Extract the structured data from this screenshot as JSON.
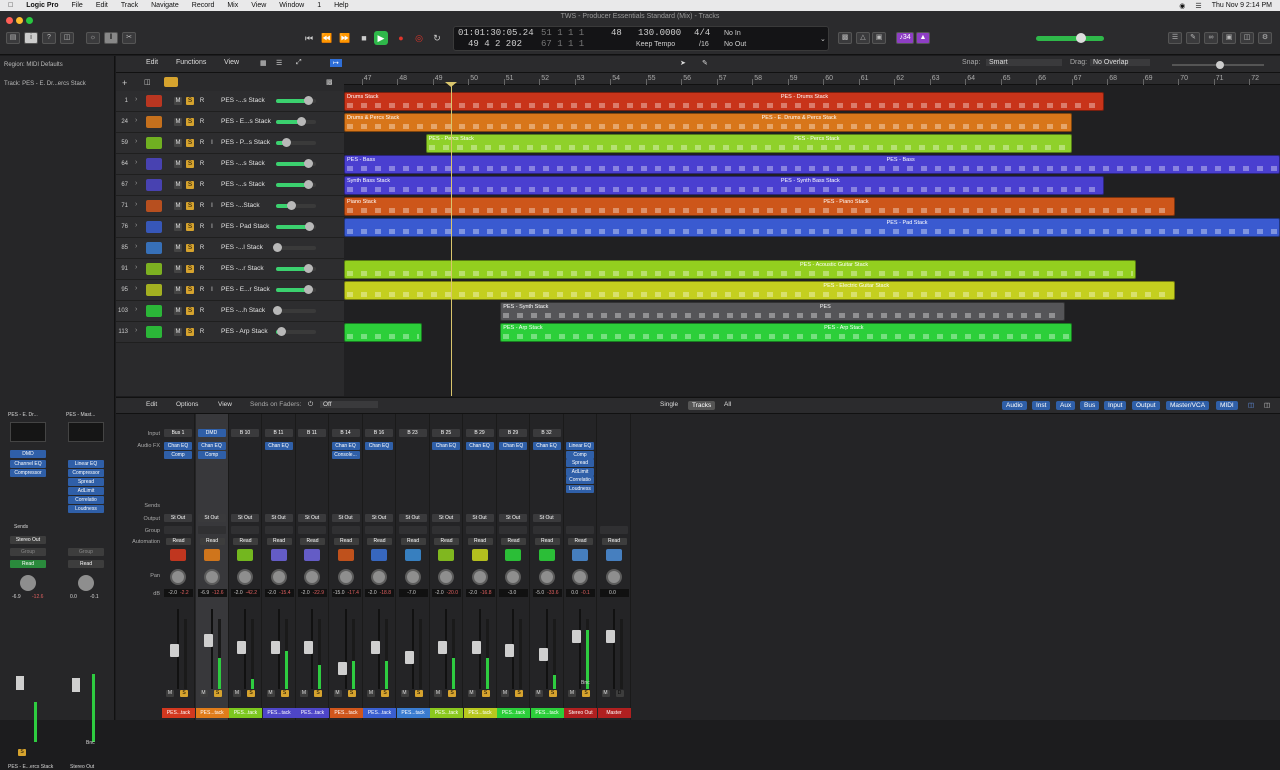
{
  "menubar": {
    "app": "Logic Pro",
    "items": [
      "File",
      "Edit",
      "Track",
      "Navigate",
      "Record",
      "Mix",
      "View",
      "Window",
      "1",
      "Help"
    ],
    "clock": "Thu Nov 9  2:14 PM"
  },
  "window": {
    "title": "TWS - Producer Essentials Standard (Mix) - Tracks"
  },
  "lcd": {
    "time": "01:01:30:05.24",
    "bars": "49  4  2  202",
    "loc1": "51  1  1     1",
    "loc2": "67  1  1     1",
    "bar_num": "48",
    "tempo": "130.0000",
    "tempo_label": "Keep Tempo",
    "sig": "4/4",
    "div": "/16",
    "in": "No In",
    "out": "No Out",
    "badge": "♪34"
  },
  "inspector": {
    "region": "Region: MIDI Defaults",
    "track": "Track: PES - E. Dr...ercs Stack",
    "strip1": {
      "name": "PES - E. Dr...",
      "setting": "DMD",
      "fx": [
        "Channel EQ",
        "Compressor"
      ],
      "sends": "Sends",
      "out": "Stereo Out",
      "group": "Group",
      "read": "Read",
      "db1": "-6.9",
      "db2": "-12.6",
      "label": "PES - E...ercs Stack"
    },
    "strip2": {
      "name": "PES - Mast...",
      "fx": [
        "Linear EQ",
        "Compressor",
        "Spread",
        "AdLimit",
        "Correlatio",
        "Loudness"
      ],
      "out": "Stereo Out",
      "group": "Group",
      "read": "Read",
      "db1": "0.0",
      "db2": "-0.1",
      "bnc": "Bnc",
      "label": "Stereo Out"
    }
  },
  "mainhdr": {
    "edit": "Edit",
    "functions": "Functions",
    "view": "View",
    "snap_label": "Snap:",
    "snap": "Smart",
    "drag_label": "Drag:",
    "drag": "No Overlap"
  },
  "ruler": [
    "47",
    "48",
    "49",
    "50",
    "51",
    "52",
    "53",
    "54",
    "55",
    "56",
    "57",
    "58",
    "59",
    "60",
    "61",
    "62",
    "63",
    "64",
    "65",
    "66",
    "67",
    "68",
    "69",
    "70",
    "71",
    "72"
  ],
  "tracks": [
    {
      "num": "1",
      "name": "PES -...s Stack",
      "color": "#d2381f",
      "vol": 0.85,
      "m": "M",
      "s": "S",
      "r": "R",
      "i": ""
    },
    {
      "num": "24",
      "name": "PES - E...s Stack",
      "color": "#e07c1a",
      "vol": 0.68,
      "m": "M",
      "s": "S",
      "r": "R",
      "i": ""
    },
    {
      "num": "59",
      "name": "PES - P...s Stack",
      "color": "#7cc81f",
      "vol": 0.25,
      "m": "M",
      "s": "S",
      "r": "R",
      "i": "I"
    },
    {
      "num": "64",
      "name": "PES -...s Stack",
      "color": "#4e46c8",
      "vol": 0.85,
      "m": "M",
      "s": "S",
      "r": "R",
      "i": ""
    },
    {
      "num": "67",
      "name": "PES -...s Stack",
      "color": "#4e46c8",
      "vol": 0.85,
      "m": "M",
      "s": "S",
      "r": "R",
      "i": ""
    },
    {
      "num": "71",
      "name": "PES -...Stack",
      "color": "#d0561c",
      "vol": 0.4,
      "m": "M",
      "s": "S",
      "r": "R",
      "i": "I"
    },
    {
      "num": "76",
      "name": "PES - Pad Stack",
      "color": "#3a5fd0",
      "vol": 0.9,
      "m": "M",
      "s": "S",
      "r": "R",
      "i": "I"
    },
    {
      "num": "85",
      "name": "PES -...l Stack",
      "color": "#3a7cd0",
      "vol": 0.0,
      "m": "M",
      "s": "S",
      "r": "R",
      "i": ""
    },
    {
      "num": "91",
      "name": "PES -...r Stack",
      "color": "#8bc81f",
      "vol": 0.85,
      "m": "M",
      "s": "S",
      "r": "R",
      "i": ""
    },
    {
      "num": "95",
      "name": "PES - E...r Stack",
      "color": "#b8c81f",
      "vol": 0.85,
      "m": "M",
      "s": "S",
      "r": "R",
      "i": "I"
    },
    {
      "num": "103",
      "name": "PES -...h Stack",
      "color": "#2ccf3a",
      "vol": 0.0,
      "m": "M",
      "s": "S",
      "r": "R",
      "i": ""
    },
    {
      "num": "113",
      "name": "PES - Arp Stack",
      "color": "#2ccf3a",
      "vol": 0.1,
      "m": "M",
      "s": "S",
      "r": "R",
      "i": ""
    }
  ],
  "regions": [
    {
      "row": 0,
      "start": 46.5,
      "end": 67.9,
      "color": "#c8341a",
      "labels": [
        "Drums Stack",
        "PES - Drums Stack"
      ]
    },
    {
      "row": 1,
      "start": 46.5,
      "end": 67.0,
      "color": "#d8761a",
      "labels": [
        "Drums & Percs Stack",
        "PES - E. Drums & Percs Stack"
      ]
    },
    {
      "row": 2,
      "start": 48.8,
      "end": 67.0,
      "color": "#8fd12a",
      "labels": [
        "PES - Percs Stack",
        "PES - Percs Stack"
      ]
    },
    {
      "row": 3,
      "start": 46.5,
      "end": 73.0,
      "color": "#4a3fd0",
      "labels": [
        "PES - Bass",
        "PES - Bass"
      ]
    },
    {
      "row": 4,
      "start": 46.5,
      "end": 67.9,
      "color": "#4a3fd0",
      "labels": [
        "Synth Bass Stack",
        "PES - Synth Bass Stack"
      ]
    },
    {
      "row": 5,
      "start": 46.5,
      "end": 69.9,
      "color": "#cd561a",
      "labels": [
        "Piano Stack",
        "PES - Piano Stack"
      ]
    },
    {
      "row": 6,
      "start": 46.5,
      "end": 73.0,
      "color": "#3a5ad0",
      "labels": [
        "",
        "PES - Pad Stack"
      ]
    },
    {
      "row": 8,
      "start": 46.5,
      "end": 68.8,
      "color": "#93cf1f",
      "labels": [
        "",
        "PES - Acoustic Guitar Stack"
      ]
    },
    {
      "row": 9,
      "start": 46.5,
      "end": 69.9,
      "color": "#c4cf1f",
      "labels": [
        "",
        "PES - Electric Guitar Stack"
      ]
    },
    {
      "row": 10,
      "start": 50.9,
      "end": 66.8,
      "color": "#555558",
      "labels": [
        "PES - Synth Stack",
        "PES"
      ]
    },
    {
      "row": 11,
      "start": 46.5,
      "end": 48.7,
      "color": "#2ccf3a",
      "labels": [
        "",
        ""
      ]
    },
    {
      "row": 11,
      "start": 50.9,
      "end": 67.0,
      "color": "#2ccf3a",
      "labels": [
        "PES - Arp Stack",
        "PES - Arp Stack"
      ]
    }
  ],
  "mixhdr": {
    "edit": "Edit",
    "options": "Options",
    "view": "View",
    "sends_label": "Sends on Faders:",
    "sends_val": "Off",
    "single": "Single",
    "tracks": "Tracks",
    "all": "All",
    "filters": [
      "Audio",
      "Inst",
      "Aux",
      "Bus",
      "Input",
      "Output",
      "Master/VCA",
      "MIDI"
    ]
  },
  "mixlabels": {
    "input": "Input",
    "fx": "Audio FX",
    "sends": "Sends",
    "output": "Output",
    "group": "Group",
    "auto": "Automation",
    "pan": "Pan",
    "db": "dB"
  },
  "channels": [
    {
      "input": "Bus 1",
      "fx": [
        "Chan EQ",
        "Comp"
      ],
      "out": "St Out",
      "read": "Read",
      "db1": "-2.0",
      "db2": "-2.2",
      "fader": 0.5,
      "meter": 0.0,
      "color": "#d2381f",
      "icon": "#d2381f",
      "name": "PES...tack"
    },
    {
      "input": "DMD",
      "fx": [
        "Chan EQ",
        "Comp"
      ],
      "out": "St Out",
      "read": "Read",
      "db1": "-6.9",
      "db2": "-12.6",
      "fader": 0.65,
      "meter": 0.45,
      "color": "#e07c1a",
      "icon": "#e07c1a",
      "name": "PES...tack"
    },
    {
      "input": "B 10",
      "fx": [],
      "out": "St Out",
      "read": "Read",
      "db1": "-2.0",
      "db2": "-42.2",
      "fader": 0.55,
      "meter": 0.15,
      "color": "#7cc81f",
      "icon": "#7cc81f",
      "name": "PES...tack"
    },
    {
      "input": "B 11",
      "fx": [
        "Chan EQ"
      ],
      "out": "St Out",
      "read": "Read",
      "db1": "-2.0",
      "db2": "-15.4",
      "fader": 0.55,
      "meter": 0.55,
      "color": "#4e46c8",
      "icon": "#6b63d8",
      "name": "PES...tack"
    },
    {
      "input": "B 11",
      "fx": [],
      "out": "St Out",
      "read": "Read",
      "db1": "-2.0",
      "db2": "-22.9",
      "fader": 0.55,
      "meter": 0.35,
      "color": "#4e46c8",
      "icon": "#6b63d8",
      "name": "PES...tack"
    },
    {
      "input": "B 14",
      "fx": [
        "Chan EQ",
        "Console..."
      ],
      "out": "St Out",
      "read": "Read",
      "db1": "-15.0",
      "db2": "-17.4",
      "fader": 0.25,
      "meter": 0.4,
      "color": "#d0561c",
      "icon": "#d0561c",
      "name": "PES...tack"
    },
    {
      "input": "B 16",
      "fx": [
        "Chan EQ"
      ],
      "out": "St Out",
      "read": "Read",
      "db1": "-2.0",
      "db2": "-18.8",
      "fader": 0.55,
      "meter": 0.4,
      "color": "#3a5fd0",
      "icon": "#3a6fd0",
      "name": "PES...tack"
    },
    {
      "input": "B 23",
      "fx": [],
      "out": "St Out",
      "read": "Read",
      "db1": "-7.0",
      "db2": "",
      "fader": 0.4,
      "meter": 0.0,
      "color": "#3a7cd0",
      "icon": "#3a8ad0",
      "name": "PES...tack"
    },
    {
      "input": "B 25",
      "fx": [
        "Chan EQ"
      ],
      "out": "St Out",
      "read": "Read",
      "db1": "-2.0",
      "db2": "-20.0",
      "fader": 0.55,
      "meter": 0.45,
      "color": "#8bc81f",
      "icon": "#8bc81f",
      "name": "PES...tack"
    },
    {
      "input": "B 29",
      "fx": [
        "Chan EQ"
      ],
      "out": "St Out",
      "read": "Read",
      "db1": "-2.0",
      "db2": "-16.8",
      "fader": 0.55,
      "meter": 0.45,
      "color": "#b8c81f",
      "icon": "#c4cf1f",
      "name": "PES...tack"
    },
    {
      "input": "B 29",
      "fx": [
        "Chan EQ"
      ],
      "out": "St Out",
      "read": "Read",
      "db1": "-3.0",
      "db2": "",
      "fader": 0.5,
      "meter": 0.0,
      "color": "#2ccf3a",
      "icon": "#2ccf3a",
      "name": "PES...tack"
    },
    {
      "input": "B 32",
      "fx": [
        "Chan EQ"
      ],
      "out": "St Out",
      "read": "Read",
      "db1": "-5.0",
      "db2": "-33.6",
      "fader": 0.45,
      "meter": 0.2,
      "color": "#2ccf3a",
      "icon": "#2ccf3a",
      "name": "PES...tack"
    },
    {
      "input": "",
      "fx": [
        "Linear EQ",
        "Comp",
        "Spread",
        "AdLimit",
        "Correlatio",
        "Loudness"
      ],
      "out": "",
      "read": "Read",
      "db1": "0.0",
      "db2": "-0.1",
      "fader": 0.7,
      "meter": 0.85,
      "color": "#b02020",
      "icon": "#4a8ad0",
      "name": "Stereo Out",
      "bnc": "Bnc"
    },
    {
      "input": "",
      "fx": [],
      "out": "",
      "read": "Read",
      "db1": "0.0",
      "db2": "",
      "fader": 0.7,
      "meter": 0.0,
      "color": "#b02020",
      "icon": "#4a8ad0",
      "name": "Master"
    }
  ]
}
